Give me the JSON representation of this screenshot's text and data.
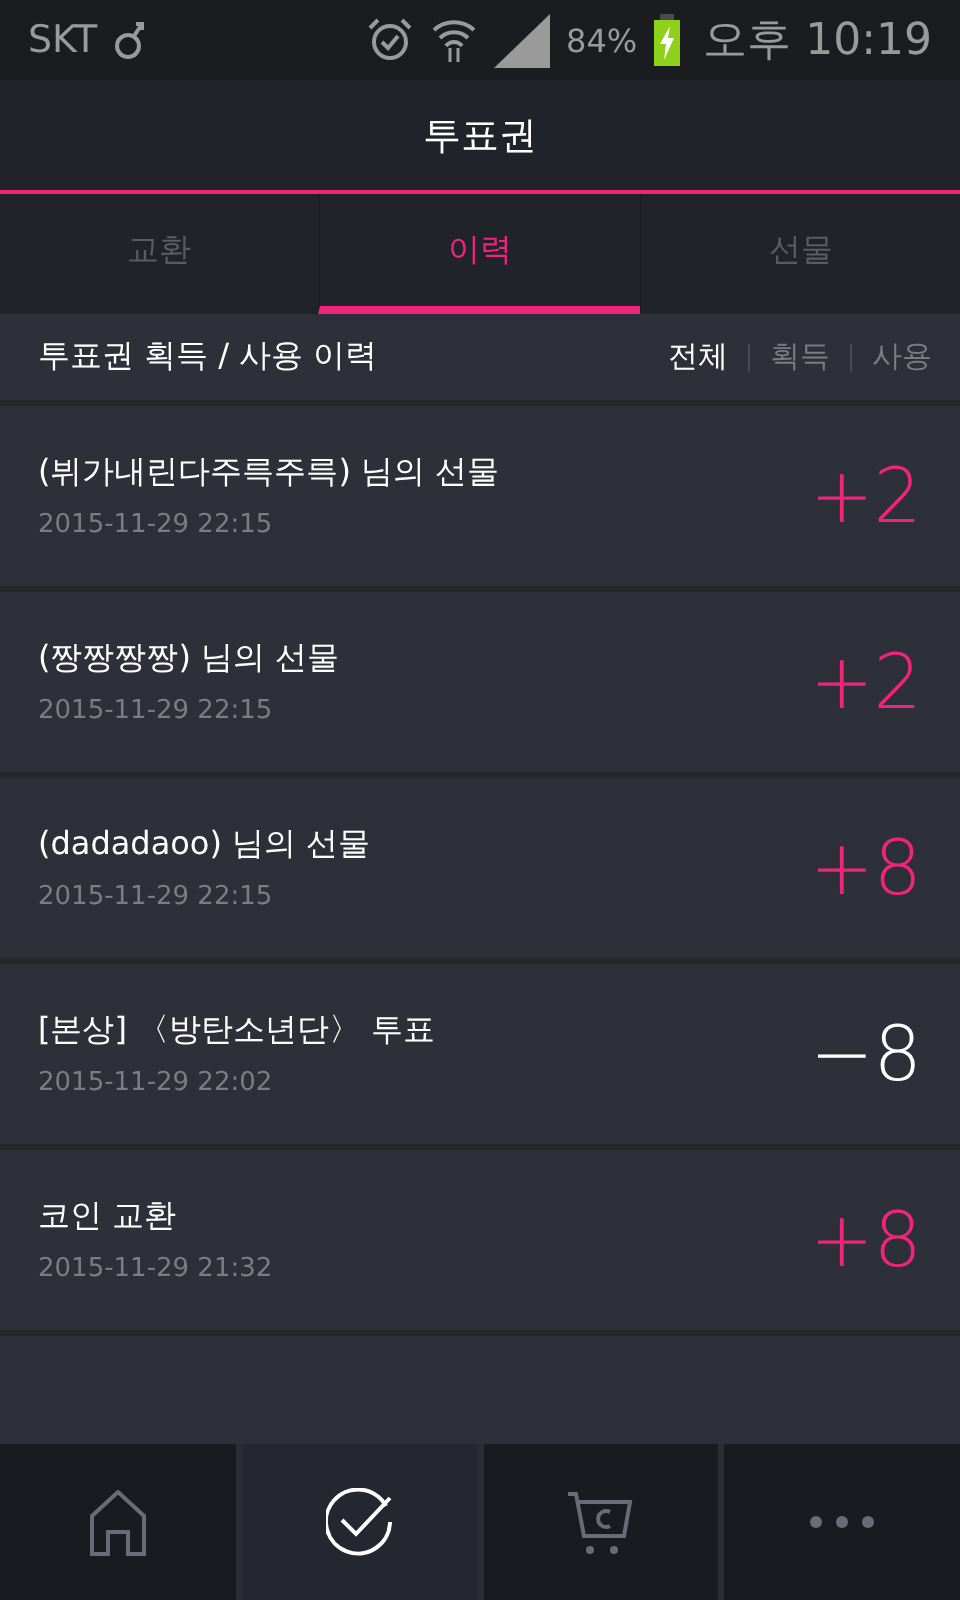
{
  "status_bar": {
    "carrier": "SKT",
    "battery": "84%",
    "time": "오후 10:19"
  },
  "header": {
    "title": "투표권"
  },
  "tabs": [
    {
      "label": "교환",
      "selected": false
    },
    {
      "label": "이력",
      "selected": true
    },
    {
      "label": "선물",
      "selected": false
    }
  ],
  "history": {
    "title": "투표권 획득 / 사용 이력",
    "filters": [
      {
        "label": "전체",
        "selected": true
      },
      {
        "label": "획득",
        "selected": false
      },
      {
        "label": "사용",
        "selected": false
      }
    ],
    "rows": [
      {
        "title": "(뷔가내린다주륵주륵) 님의 선물",
        "date": "2015-11-29 22:15",
        "amount": "+2",
        "kind": "gain"
      },
      {
        "title": "(짱짱짱짱) 님의 선물",
        "date": "2015-11-29 22:15",
        "amount": "+2",
        "kind": "gain"
      },
      {
        "title": "(dadadaoo) 님의 선물",
        "date": "2015-11-29 22:15",
        "amount": "+8",
        "kind": "gain"
      },
      {
        "title": "[본상] 〈방탄소년단〉 투표",
        "date": "2015-11-29 22:02",
        "amount": "−8",
        "kind": "spend"
      },
      {
        "title": "코인 교환",
        "date": "2015-11-29 21:32",
        "amount": "+8",
        "kind": "gain"
      }
    ]
  },
  "bottom_nav": [
    {
      "kind": "home",
      "selected": false
    },
    {
      "kind": "vote",
      "selected": true
    },
    {
      "kind": "shop",
      "selected": false
    },
    {
      "kind": "more",
      "selected": false
    }
  ]
}
